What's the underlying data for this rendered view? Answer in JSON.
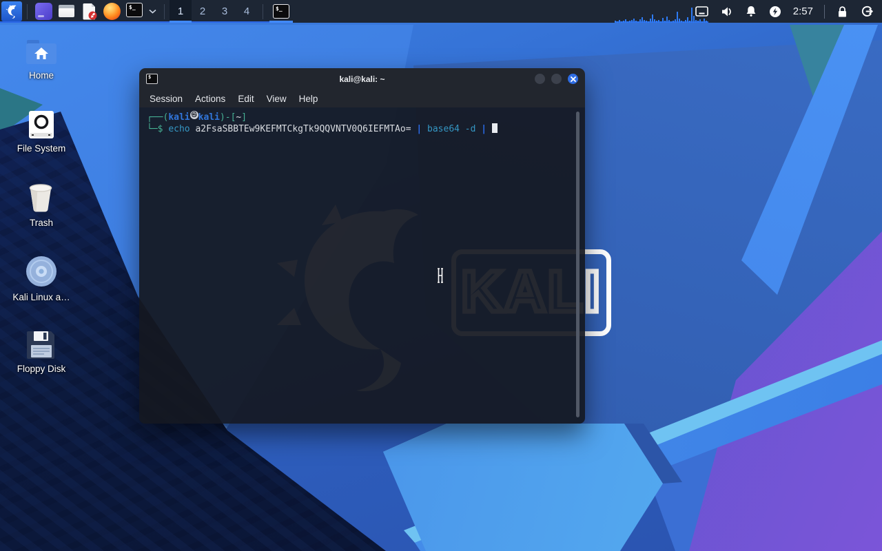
{
  "panel": {
    "workspaces": {
      "items": [
        "1",
        "2",
        "3",
        "4"
      ],
      "active": "1"
    },
    "clock": "2:57",
    "terminal_glyph": "$_",
    "cpu_graph_bars": [
      3,
      2,
      4,
      2,
      3,
      5,
      2,
      3,
      4,
      6,
      3,
      2,
      5,
      8,
      4,
      3,
      2,
      6,
      12,
      5,
      3,
      4,
      2,
      7,
      3,
      9,
      4,
      2,
      3,
      5,
      16,
      6,
      3,
      2,
      4,
      8,
      3,
      22,
      10,
      4,
      3,
      5,
      2,
      6,
      3
    ]
  },
  "desktop": {
    "icons": [
      {
        "label": "Home"
      },
      {
        "label": "File System"
      },
      {
        "label": "Trash"
      },
      {
        "label": "Kali Linux a…"
      },
      {
        "label": "Floppy Disk"
      }
    ]
  },
  "wallpaper": {
    "logo_text": "KALI"
  },
  "terminal_window": {
    "title": "kali@kali: ~",
    "icon_glyph": "$",
    "menu": [
      {
        "label": "Session"
      },
      {
        "label": "Actions"
      },
      {
        "label": "Edit"
      },
      {
        "label": "View"
      },
      {
        "label": "Help"
      }
    ],
    "prompt": {
      "l1_open": "┌──(",
      "l1_user": "kali",
      "l1_at": "㉿",
      "l1_host": "kali",
      "l1_mid": ")-[",
      "l1_path": "~",
      "l1_close": "]",
      "l2_prompt": "└─$",
      "l2_cmd": "echo",
      "l2_arg": " a2FsaSBBTEw9KEFMTCkgTk9QQVNTV0Q6IEFMTAo= ",
      "l2_pipe1": "|",
      "l2_cmd2": " base64",
      "l2_opt": " -d",
      "l2_pipe2": " |"
    }
  }
}
